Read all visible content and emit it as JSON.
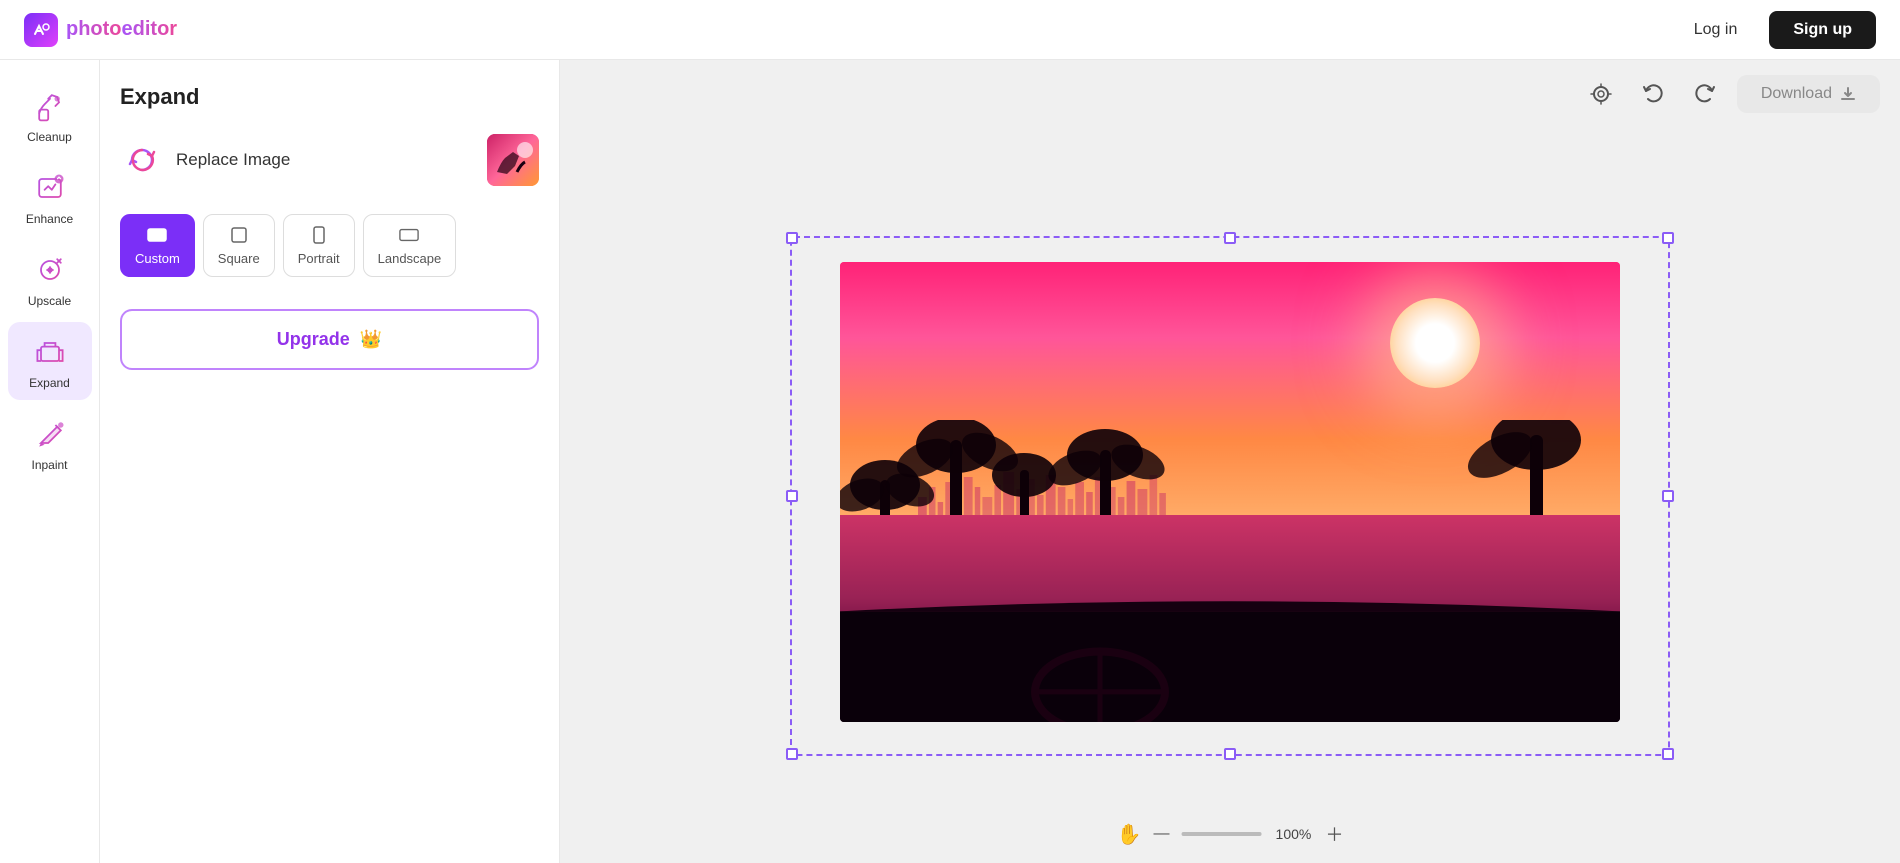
{
  "app": {
    "name_photo": "photo",
    "name_editor": "editor",
    "logo_icon": "AI"
  },
  "nav": {
    "login_label": "Log in",
    "signup_label": "Sign up"
  },
  "sidebar": {
    "items": [
      {
        "id": "cleanup",
        "label": "Cleanup",
        "icon": "cleanup-icon"
      },
      {
        "id": "enhance",
        "label": "Enhance",
        "icon": "enhance-icon"
      },
      {
        "id": "upscale",
        "label": "Upscale",
        "icon": "upscale-icon"
      },
      {
        "id": "expand",
        "label": "Expand",
        "icon": "expand-icon",
        "active": true
      },
      {
        "id": "inpaint",
        "label": "Inpaint",
        "icon": "inpaint-icon"
      }
    ]
  },
  "panel": {
    "title": "Expand",
    "replace_image_label": "Replace Image",
    "aspect_ratios": [
      {
        "id": "custom",
        "label": "Custom",
        "active": true
      },
      {
        "id": "square",
        "label": "Square",
        "active": false
      },
      {
        "id": "portrait",
        "label": "Portrait",
        "active": false
      },
      {
        "id": "landscape",
        "label": "Landscape",
        "active": false
      }
    ],
    "upgrade_label": "Upgrade"
  },
  "toolbar": {
    "download_label": "Download"
  },
  "canvas": {
    "zoom_percent": "100%"
  }
}
